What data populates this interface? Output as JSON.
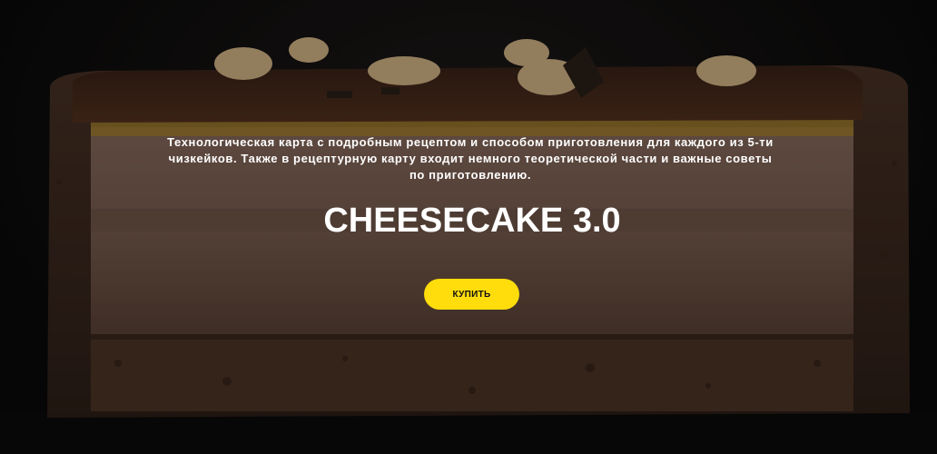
{
  "hero": {
    "description": "Технологическая карта с подробным рецептом и способом приготовления для каждого из 5-ти чизкейков. Также в рецептурную карту входит немного теоретической части и важные советы по приготовлению.",
    "title": "CHEESECAKE 3.0",
    "button_label": "КУПИТЬ"
  },
  "colors": {
    "accent": "#ffdc0c",
    "text": "#ffffff",
    "background": "#0d0d0d"
  }
}
